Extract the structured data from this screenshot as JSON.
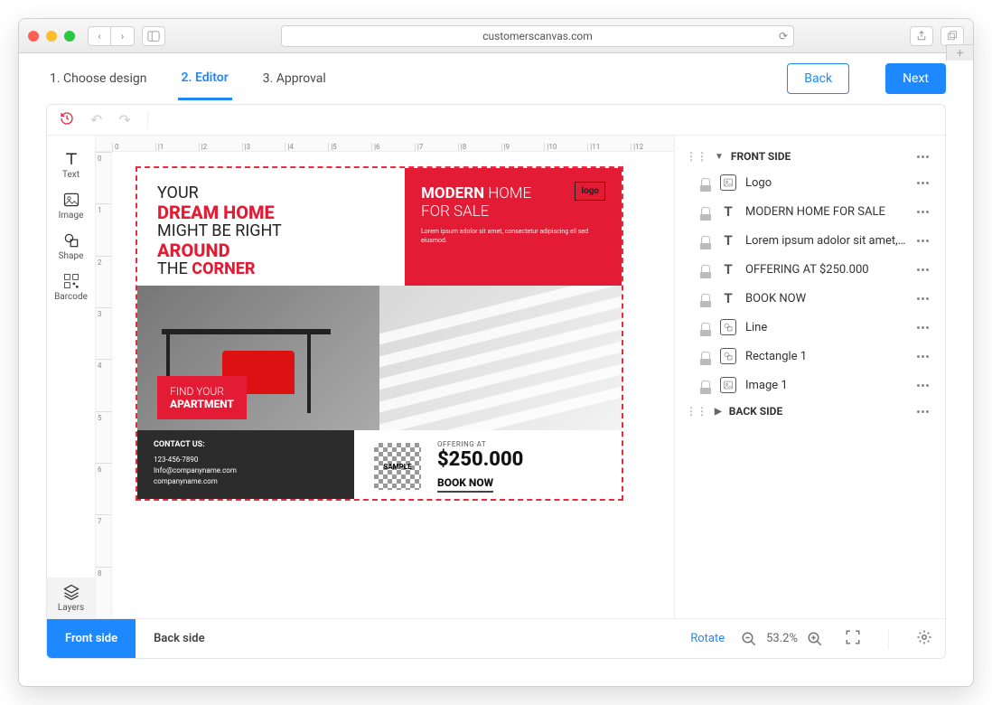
{
  "browser": {
    "url": "customerscanvas.com"
  },
  "steps": {
    "s1": "1. Choose design",
    "s2": "2. Editor",
    "s3": "3. Approval",
    "back": "Back",
    "next": "Next"
  },
  "tools": {
    "text": "Text",
    "image": "Image",
    "shape": "Shape",
    "barcode": "Barcode",
    "layers": "Layers"
  },
  "rulerH": [
    "0",
    "|1",
    "|2",
    "|3",
    "|4",
    "|5",
    "|6",
    "|7",
    "|8",
    "|9",
    "|10",
    "|11",
    "|12"
  ],
  "rulerV": [
    "0",
    "1",
    "2",
    "3",
    "4",
    "5",
    "6",
    "7",
    "8"
  ],
  "canvas": {
    "logo": "logo",
    "hl1": "YOUR",
    "hl2": "DREAM HOME",
    "hl3": "MIGHT BE RIGHT",
    "hl4": "AROUND",
    "hl5": "THE ",
    "hl6": "CORNER",
    "modern": "MODERN",
    "home": " HOME",
    "forsale": "FOR SALE",
    "lorem": "Lorem ipsum adolor sit amet, consectetur adipiscing ell sed eiusmod.",
    "find1": "FIND YOUR",
    "find2": "APARTMENT",
    "contactTitle": "CONTACT US:",
    "phone": "123-456-7890",
    "email": "Info@companyname.com",
    "site": "companyname.com",
    "qr": "SAMPLE",
    "offering": "OFFERING AT",
    "price": "$250.000",
    "book": "BOOK NOW"
  },
  "panel": {
    "frontHeader": "FRONT SIDE",
    "backHeader": "BACK SIDE",
    "layers": [
      {
        "label": "Logo",
        "type": "image"
      },
      {
        "label": "MODERN HOME FOR SALE",
        "type": "text"
      },
      {
        "label": "Lorem ipsum adolor sit amet, cons...",
        "type": "text"
      },
      {
        "label": "OFFERING AT $250.000",
        "type": "text"
      },
      {
        "label": "BOOK NOW",
        "type": "text"
      },
      {
        "label": "Line",
        "type": "shape"
      },
      {
        "label": "Rectangle 1",
        "type": "shape"
      },
      {
        "label": "Image 1",
        "type": "image"
      }
    ]
  },
  "bottom": {
    "front": "Front side",
    "back": "Back side",
    "rotate": "Rotate",
    "zoom": "53.2%"
  }
}
